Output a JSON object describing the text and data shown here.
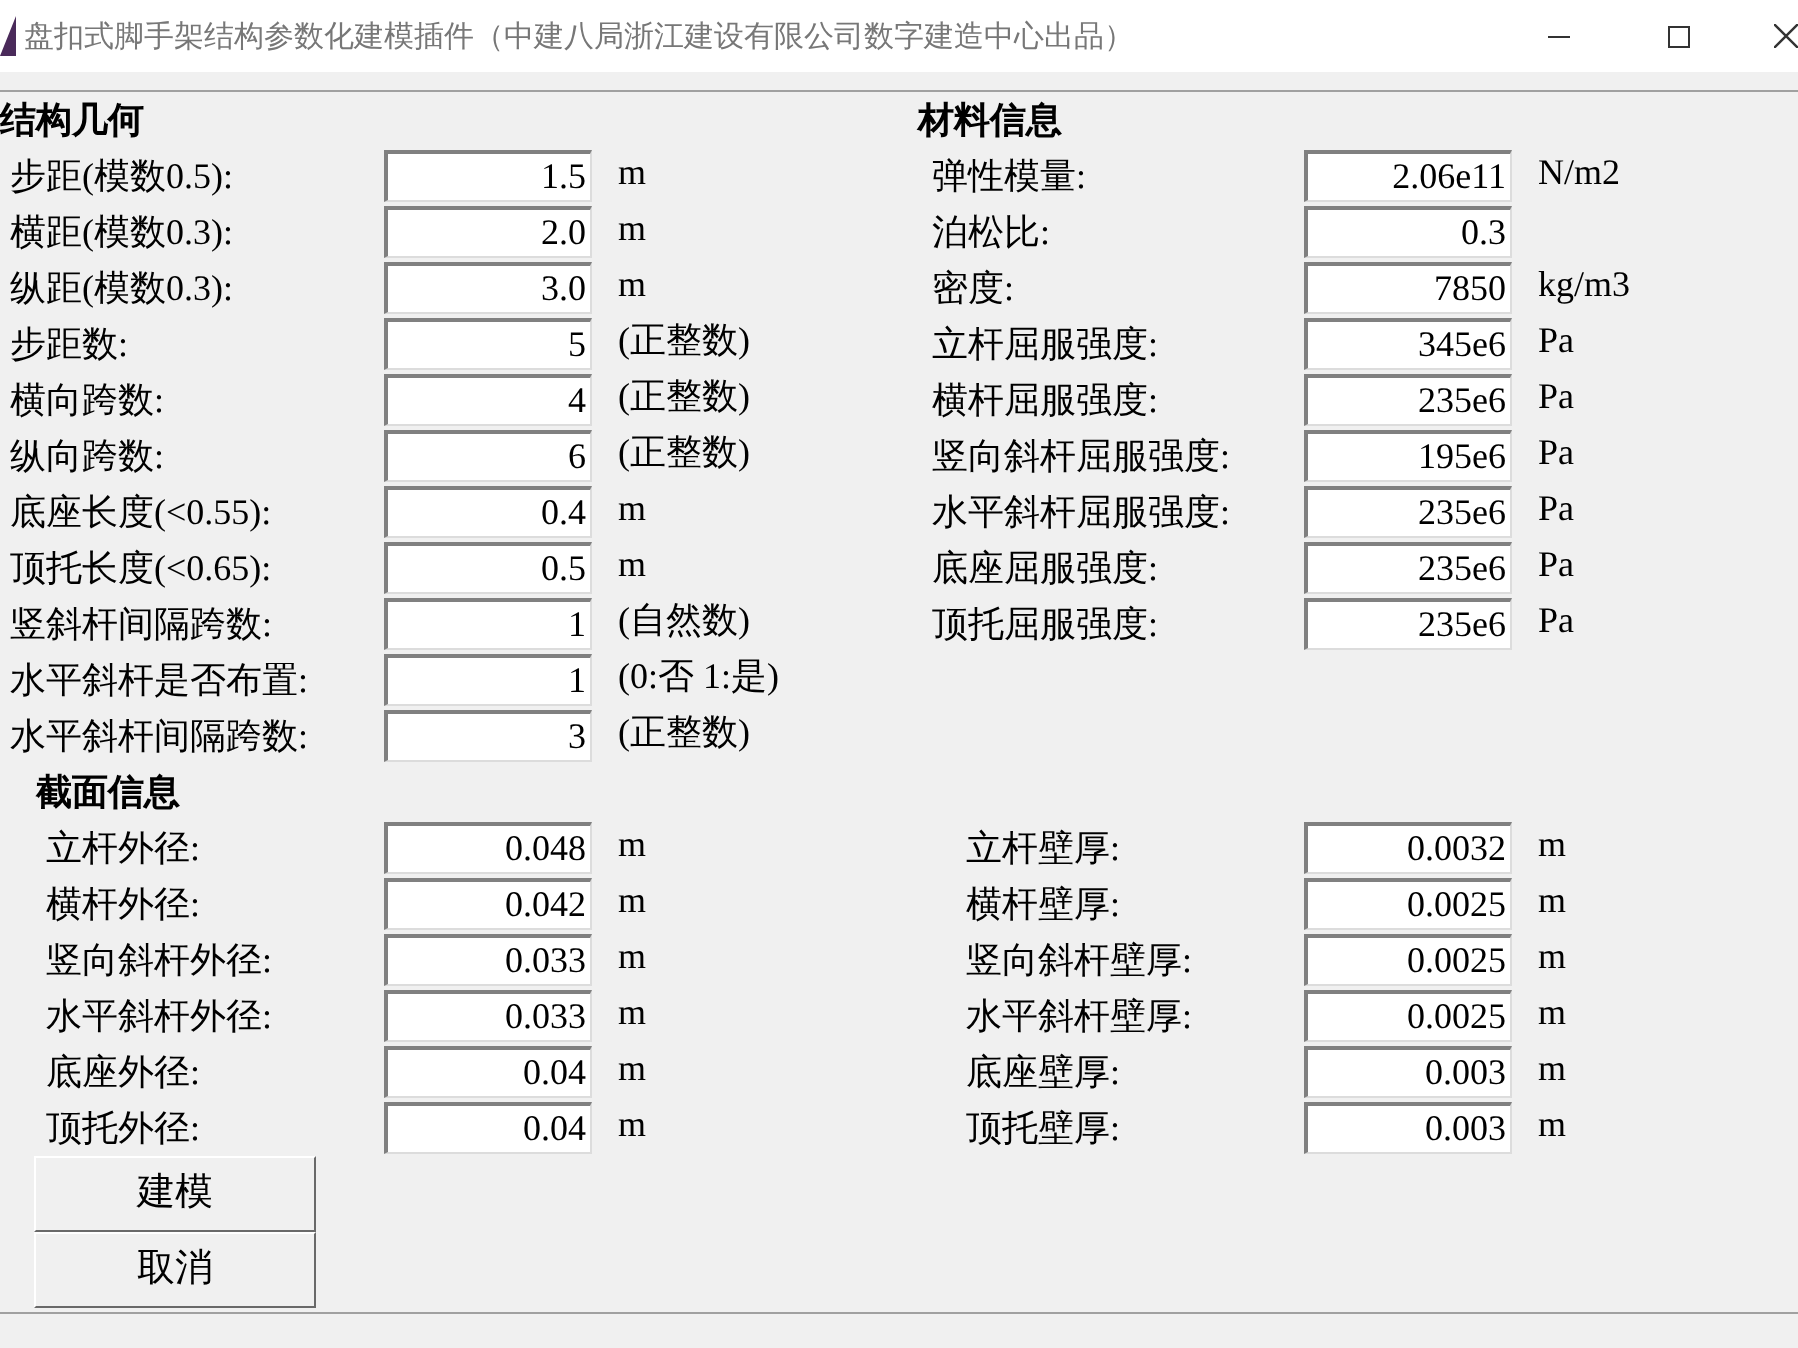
{
  "window": {
    "title": "盘扣式脚手架结构参数化建模插件（中建八局浙江建设有限公司数字建造中心出品）"
  },
  "structure": {
    "title": "结构几何",
    "fields": [
      {
        "label": "步距(模数0.5):",
        "value": "1.5",
        "unit": "m"
      },
      {
        "label": "横距(模数0.3):",
        "value": "2.0",
        "unit": "m"
      },
      {
        "label": "纵距(模数0.3):",
        "value": "3.0",
        "unit": "m"
      },
      {
        "label": "步距数:",
        "value": "5",
        "unit": "(正整数)"
      },
      {
        "label": "横向跨数:",
        "value": "4",
        "unit": "(正整数)"
      },
      {
        "label": "纵向跨数:",
        "value": "6",
        "unit": "(正整数)"
      },
      {
        "label": "底座长度(<0.55):",
        "value": "0.4",
        "unit": "m"
      },
      {
        "label": "顶托长度(<0.65):",
        "value": "0.5",
        "unit": "m"
      },
      {
        "label": "竖斜杆间隔跨数:",
        "value": "1",
        "unit": "(自然数)"
      },
      {
        "label": "水平斜杆是否布置:",
        "value": "1",
        "unit": "(0:否 1:是)"
      },
      {
        "label": "水平斜杆间隔跨数:",
        "value": "3",
        "unit": "(正整数)"
      }
    ]
  },
  "material": {
    "title": "材料信息",
    "fields": [
      {
        "label": "弹性模量:",
        "value": "2.06e11",
        "unit": "N/m2"
      },
      {
        "label": "泊松比:",
        "value": "0.3"
      },
      {
        "label": "密度:",
        "value": "7850",
        "unit": "kg/m3"
      },
      {
        "label": "立杆屈服强度:",
        "value": "345e6",
        "unit": "Pa"
      },
      {
        "label": "横杆屈服强度:",
        "value": "235e6",
        "unit": "Pa"
      },
      {
        "label": "竖向斜杆屈服强度:",
        "value": "195e6",
        "unit": "Pa"
      },
      {
        "label": "水平斜杆屈服强度:",
        "value": "235e6",
        "unit": "Pa"
      },
      {
        "label": "底座屈服强度:",
        "value": "235e6",
        "unit": "Pa"
      },
      {
        "label": "顶托屈服强度:",
        "value": "235e6",
        "unit": "Pa"
      }
    ]
  },
  "section": {
    "title": "截面信息",
    "left": [
      {
        "label": "立杆外径:",
        "value": "0.048",
        "unit": "m"
      },
      {
        "label": "横杆外径:",
        "value": "0.042",
        "unit": "m"
      },
      {
        "label": "竖向斜杆外径:",
        "value": "0.033",
        "unit": "m"
      },
      {
        "label": "水平斜杆外径:",
        "value": "0.033",
        "unit": "m"
      },
      {
        "label": "底座外径:",
        "value": "0.04",
        "unit": "m"
      },
      {
        "label": "顶托外径:",
        "value": "0.04",
        "unit": "m"
      }
    ],
    "right": [
      {
        "label": "立杆壁厚:",
        "value": "0.0032",
        "unit": "m"
      },
      {
        "label": "横杆壁厚:",
        "value": "0.0025",
        "unit": "m"
      },
      {
        "label": "竖向斜杆壁厚:",
        "value": "0.0025",
        "unit": "m"
      },
      {
        "label": "水平斜杆壁厚:",
        "value": "0.0025",
        "unit": "m"
      },
      {
        "label": "底座壁厚:",
        "value": "0.003",
        "unit": "m"
      },
      {
        "label": "顶托壁厚:",
        "value": "0.003",
        "unit": "m"
      }
    ]
  },
  "buttons": [
    "建模",
    "取消"
  ]
}
